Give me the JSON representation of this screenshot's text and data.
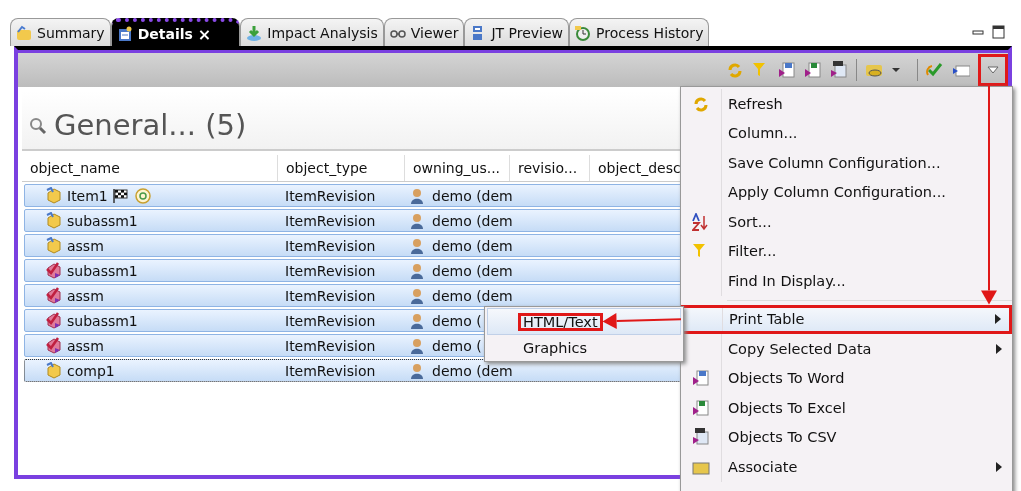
{
  "tabs": [
    {
      "label": "Summary",
      "kind": "summary",
      "selected": false
    },
    {
      "label": "Details",
      "kind": "details",
      "selected": true,
      "close": "×"
    },
    {
      "label": "Impact Analysis",
      "kind": "impact",
      "selected": false
    },
    {
      "label": "Viewer",
      "kind": "viewer",
      "selected": false
    },
    {
      "label": "JT Preview",
      "kind": "jt",
      "selected": false
    },
    {
      "label": "Process History",
      "kind": "process",
      "selected": false
    }
  ],
  "toolbar": {
    "menu_button": {
      "callout": true
    }
  },
  "section": {
    "title": "General... (5)"
  },
  "table": {
    "columns": [
      "object_name",
      "object_type",
      "owning_us...",
      "revisio...",
      "object_desc"
    ],
    "rows": [
      {
        "name": "Item1",
        "kind": "working",
        "flags": true,
        "type": "ItemRevision",
        "owner": "demo (dem",
        "selected": true,
        "focused": false
      },
      {
        "name": "subassm1",
        "kind": "working",
        "flags": false,
        "type": "ItemRevision",
        "owner": "demo (dem",
        "selected": true,
        "focused": false
      },
      {
        "name": "assm",
        "kind": "working",
        "flags": false,
        "type": "ItemRevision",
        "owner": "demo (dem",
        "selected": true,
        "focused": false
      },
      {
        "name": "subassm1",
        "kind": "released",
        "flags": false,
        "type": "ItemRevision",
        "owner": "demo (dem",
        "selected": true,
        "focused": false
      },
      {
        "name": "assm",
        "kind": "released",
        "flags": false,
        "type": "ItemRevision",
        "owner": "demo (dem",
        "selected": true,
        "focused": false
      },
      {
        "name": "subassm1",
        "kind": "released",
        "flags": false,
        "type": "ItemRevision",
        "owner": "demo (",
        "selected": true,
        "focused": false
      },
      {
        "name": "assm",
        "kind": "released",
        "flags": false,
        "type": "ItemRevision",
        "owner": "demo (",
        "selected": true,
        "focused": false
      },
      {
        "name": "comp1",
        "kind": "working",
        "flags": false,
        "type": "ItemRevision",
        "owner": "demo (dem",
        "selected": true,
        "focused": true
      }
    ]
  },
  "menu": {
    "items": [
      {
        "label": "Refresh",
        "kind": "refresh",
        "submenu": false,
        "selected": false,
        "callout": false
      },
      {
        "label": "Column...",
        "kind": "plain",
        "submenu": false,
        "selected": false,
        "callout": false
      },
      {
        "label": "Save Column Configuration...",
        "kind": "plain",
        "submenu": false,
        "selected": false,
        "callout": false
      },
      {
        "label": "Apply Column Configuration...",
        "kind": "plain",
        "submenu": false,
        "selected": false,
        "callout": false
      },
      {
        "label": "Sort...",
        "kind": "sort",
        "submenu": false,
        "selected": false,
        "callout": false
      },
      {
        "label": "Filter...",
        "kind": "filter",
        "submenu": false,
        "selected": false,
        "callout": false
      },
      {
        "label": "Find In Display...",
        "kind": "plain",
        "submenu": false,
        "selected": false,
        "callout": false
      },
      {
        "kind": "separator"
      },
      {
        "label": "Print Table",
        "kind": "plain",
        "submenu": true,
        "selected": true,
        "callout": true
      },
      {
        "label": "Copy Selected Data",
        "kind": "plain",
        "submenu": true,
        "selected": false,
        "callout": false
      },
      {
        "label": "Objects To Word",
        "kind": "word",
        "submenu": false,
        "selected": false,
        "callout": false
      },
      {
        "label": "Objects To Excel",
        "kind": "excel",
        "submenu": false,
        "selected": false,
        "callout": false
      },
      {
        "label": "Objects To CSV",
        "kind": "csv",
        "submenu": false,
        "selected": false,
        "callout": false
      },
      {
        "label": "Associate",
        "kind": "associate",
        "submenu": true,
        "selected": false,
        "callout": false
      }
    ]
  },
  "submenu": {
    "items": [
      {
        "label": "HTML/Text",
        "selected": true,
        "callout": true
      },
      {
        "label": "Graphics",
        "selected": false,
        "callout": false
      }
    ]
  }
}
